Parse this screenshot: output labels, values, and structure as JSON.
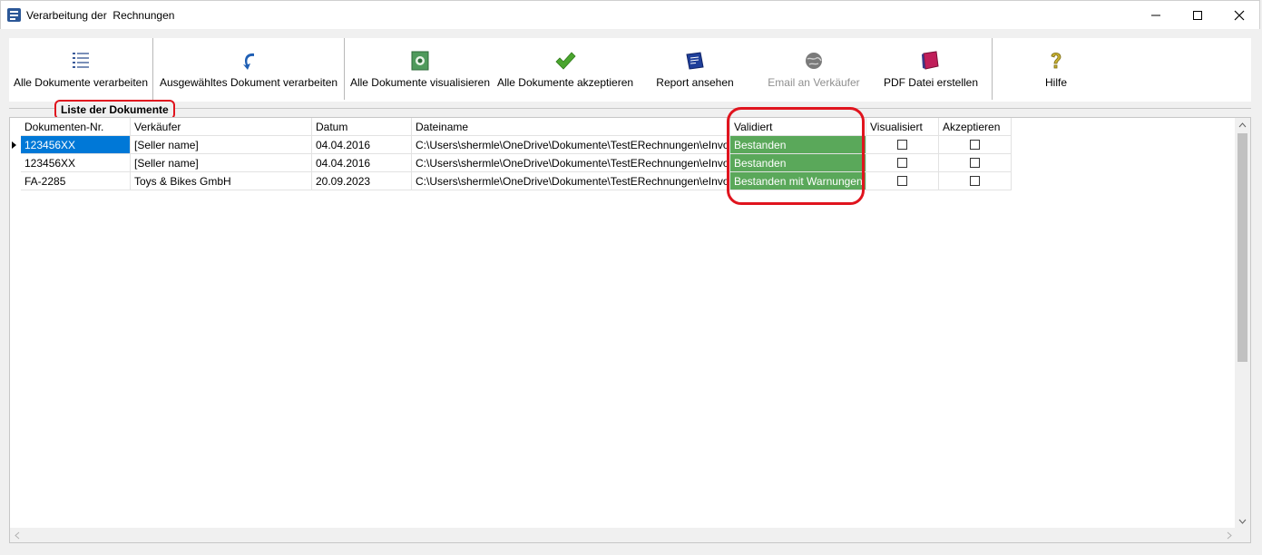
{
  "window": {
    "title": "Verarbeitung der  Rechnungen"
  },
  "toolbar": {
    "process_all": "Alle Dokumente verarbeiten",
    "process_selected": "Ausgewähltes Dokument verarbeiten",
    "visualize_all": "Alle Dokumente visualisieren",
    "accept_all": "Alle Dokumente akzeptieren",
    "view_report": "Report ansehen",
    "email_seller": "Email an Verkäufer",
    "create_pdf": "PDF Datei erstellen",
    "help": "Hilfe"
  },
  "group": {
    "label": "Liste der Dokumente"
  },
  "table": {
    "headers": {
      "doc_no": "Dokumenten-Nr.",
      "seller": "Verkäufer",
      "date": "Datum",
      "filename": "Dateiname",
      "validated": "Validiert",
      "visualized": "Visualisiert",
      "accept": "Akzeptieren"
    },
    "rows": [
      {
        "doc_no": "123456XX",
        "seller": "[Seller name]",
        "date": "04.04.2016",
        "filename": "C:\\Users\\shermle\\OneDrive\\Dokumente\\TestERechnungen\\eInvoi",
        "validated": "Bestanden",
        "visualized": false,
        "accept": false
      },
      {
        "doc_no": "123456XX",
        "seller": "[Seller name]",
        "date": "04.04.2016",
        "filename": "C:\\Users\\shermle\\OneDrive\\Dokumente\\TestERechnungen\\eInvoi",
        "validated": "Bestanden",
        "visualized": false,
        "accept": false
      },
      {
        "doc_no": "FA-2285",
        "seller": "Toys & Bikes GmbH",
        "date": "20.09.2023",
        "filename": "C:\\Users\\shermle\\OneDrive\\Dokumente\\TestERechnungen\\eInvoi",
        "validated": "Bestanden mit Warnungen",
        "visualized": false,
        "accept": false
      }
    ]
  },
  "colors": {
    "validated_ok": "#5aa85a",
    "selection": "#0078d7",
    "annotation": "#e0141e"
  }
}
